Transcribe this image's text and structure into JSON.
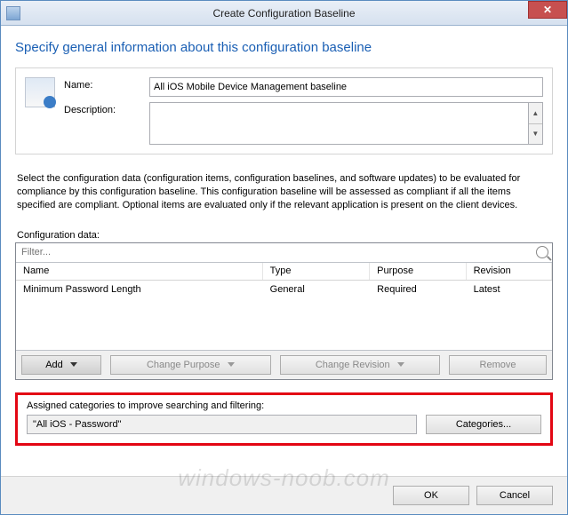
{
  "window": {
    "title": "Create Configuration Baseline"
  },
  "page": {
    "heading": "Specify general information about this configuration baseline"
  },
  "general": {
    "name_label": "Name:",
    "name_value": "All iOS Mobile Device Management baseline",
    "description_label": "Description:",
    "description_value": ""
  },
  "instruction": "Select the configuration data (configuration items, configuration baselines, and software updates) to be evaluated for compliance by this configuration baseline. This configuration baseline will be assessed as compliant if all the items specified are compliant. Optional items are evaluated only if the relevant application is present on  the client devices.",
  "config_data": {
    "label": "Configuration data:",
    "filter_placeholder": "Filter...",
    "columns": {
      "name": "Name",
      "type": "Type",
      "purpose": "Purpose",
      "revision": "Revision"
    },
    "rows": [
      {
        "name": "Minimum Password Length",
        "type": "General",
        "purpose": "Required",
        "revision": "Latest"
      }
    ],
    "buttons": {
      "add": "Add",
      "change_purpose": "Change Purpose",
      "change_revision": "Change Revision",
      "remove": "Remove"
    }
  },
  "categories": {
    "label": "Assigned categories to improve searching and filtering:",
    "value": "\"All iOS - Password\"",
    "button": "Categories..."
  },
  "footer": {
    "ok": "OK",
    "cancel": "Cancel"
  },
  "watermark": "windows-noob.com"
}
